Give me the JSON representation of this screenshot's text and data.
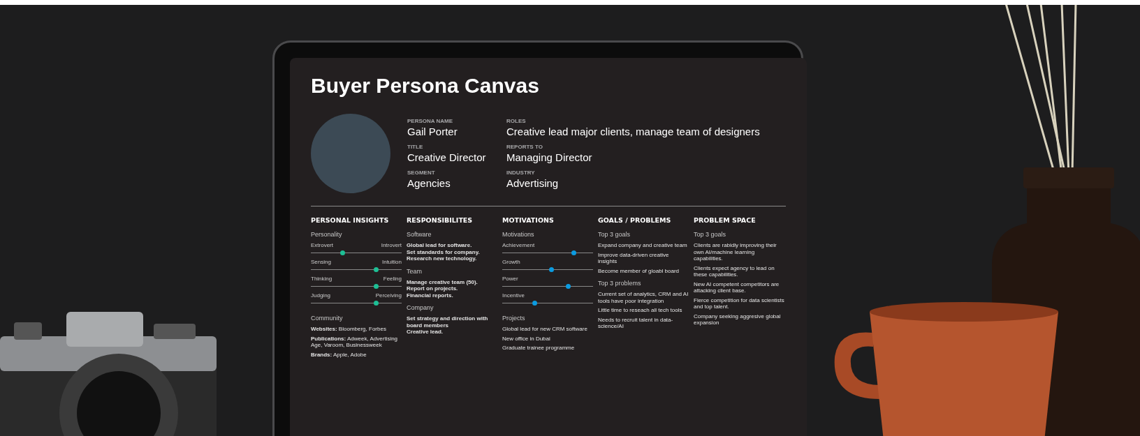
{
  "title": "Buyer Persona Canvas",
  "fields": [
    {
      "label": "PERSONA NAME",
      "value": "Gail Porter"
    },
    {
      "label": "TITLE",
      "value": "Creative Director"
    },
    {
      "label": "SEGMENT",
      "value": "Agencies"
    },
    {
      "label": "ROLES",
      "value": "Creative lead major clients, manage team of designers"
    },
    {
      "label": "REPORTS TO",
      "value": "Managing Director"
    },
    {
      "label": "INDUSTRY",
      "value": "Advertising"
    }
  ],
  "sections": [
    {
      "heading": "PERSONAL INSIGHTS",
      "blocks": [
        {
          "kind": "sliders",
          "subheading": "Personality",
          "items": [
            {
              "kind": "bipolar",
              "left": "Extrovert",
              "right": "Introvert",
              "level": 0.35
            },
            {
              "kind": "bipolar",
              "left": "Sensing",
              "right": "Intuition",
              "level": 0.72
            },
            {
              "kind": "bipolar",
              "left": "Thinking",
              "right": "Feeling",
              "level": 0.72
            },
            {
              "kind": "bipolar",
              "left": "Judging",
              "right": "Perceiving",
              "level": 0.72
            }
          ]
        },
        {
          "kind": "list",
          "subheading": "Community",
          "items": [
            "**Websites:** Bloomberg, Forbes",
            "**Publications:** Adweek, Advertising Age, Varoom, Businessweek",
            "**Brands:** Apple, Adobe"
          ]
        }
      ]
    },
    {
      "heading": "RESPONSIBILITES",
      "blocks": [
        {
          "kind": "lines",
          "subheading": "Software",
          "items": [
            "Global lead for software.",
            "Set standards for company.",
            "Research new technology."
          ]
        },
        {
          "kind": "lines",
          "subheading": "Team",
          "items": [
            "Manage creative team (50).",
            "Report on projects.",
            "Financial reports."
          ]
        },
        {
          "kind": "lines",
          "subheading": "Company",
          "items": [
            "Set strategy and direction with board members",
            "Creative lead."
          ]
        }
      ]
    },
    {
      "heading": "MOTIVATIONS",
      "blocks": [
        {
          "kind": "sliders",
          "subheading": "Motivations",
          "items": [
            {
              "kind": "single",
              "left": "Achievement",
              "level": 0.79
            },
            {
              "kind": "single",
              "left": "Growth",
              "level": 0.54
            },
            {
              "kind": "single",
              "left": "Power",
              "level": 0.73
            },
            {
              "kind": "single",
              "left": "Incentive",
              "level": 0.36
            }
          ]
        },
        {
          "kind": "list",
          "subheading": "Projects",
          "items": [
            "Global lead for new CRM software",
            "New office in Dubai",
            "Graduate trainee programme"
          ]
        }
      ]
    },
    {
      "heading": "GOALS / PROBLEMS",
      "blocks": [
        {
          "kind": "list",
          "subheading": "Top 3 goals",
          "items": [
            "Expand company and creative team",
            "Improve data-driven creative insights",
            "Become member of gloabl board"
          ]
        },
        {
          "kind": "list",
          "subheading": "Top 3 problems",
          "items": [
            "Current set of analytics, CRM and AI tools have poor integration",
            "Little time to reseach all tech tools",
            "Needs to recruit talent in data-science/AI"
          ]
        }
      ]
    },
    {
      "heading": "PROBLEM SPACE",
      "blocks": [
        {
          "kind": "list",
          "subheading": "Top 3 goals",
          "items": [
            "Clients are rabidly improving their own AI/machine learning capabilities.",
            "Clients expect agency to lead on these capabilities.",
            "New AI competent competitors are attacking client base.",
            "Fierce competition for data scientists and top talent.",
            "Company seeking aggresive global expansion"
          ]
        }
      ]
    }
  ]
}
